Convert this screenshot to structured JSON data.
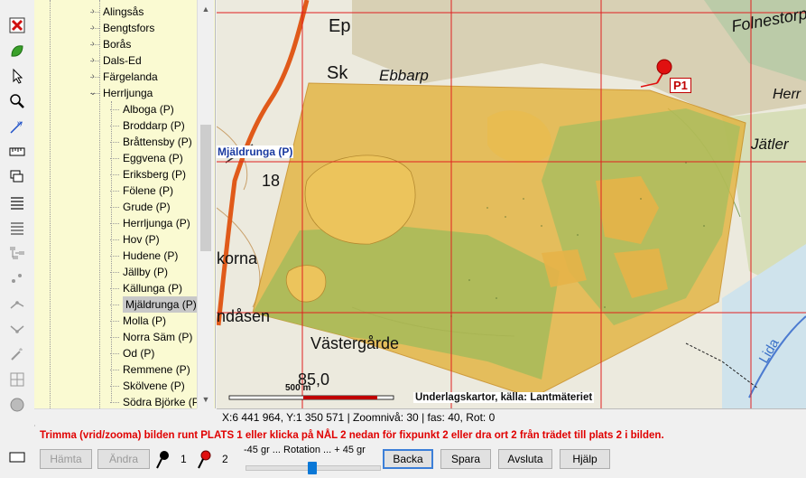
{
  "toolbar": {
    "tools": [
      "close-icon",
      "leaf-icon",
      "pointer-icon",
      "zoom-icon",
      "measure-icon",
      "ruler-icon",
      "layers-icon",
      "list-icon",
      "list2-icon",
      "network-icon",
      "dots-icon",
      "line-icon",
      "line2-icon",
      "wand-icon",
      "grid-icon",
      "circle-icon",
      "rectangle-icon"
    ]
  },
  "tree": {
    "top_items": [
      "Alingsås",
      "Bengtsfors",
      "Borås",
      "Dals-Ed",
      "Färgelanda"
    ],
    "expanded_item": "Herrljunga",
    "children": [
      "Alboga (P)",
      "Broddarp (P)",
      "Bråttensby (P)",
      "Eggvena (P)",
      "Eriksberg (P)",
      "Fölene (P)",
      "Grude (P)",
      "Herrljunga (P)",
      "Hov (P)",
      "Hudene (P)",
      "Jällby (P)",
      "Källunga (P)",
      "Mjäldrunga (P)",
      "Molla (P)",
      "Norra Säm (P)",
      "Od (P)",
      "Remmene (P)",
      "Skölvene (P)",
      "Södra Björke (P)"
    ],
    "selected": "Mjäldrunga (P)"
  },
  "map": {
    "labels": {
      "ep": "Ep",
      "ebbarp": "Ebbarp",
      "sk": "Sk",
      "mjaldrunga": "Mjäldrunga (P)",
      "num18": "18",
      "korna": "korna",
      "ndasen": "ndåsen",
      "vastergarde": "Västergårde",
      "num85": "85,0",
      "folnestorp": "Folnestorp",
      "jatler": "Jätler",
      "lida": "Lida",
      "herr": "Herr"
    },
    "marker_label": "P1",
    "scale_label": "500 m",
    "source_label": "Underlagskartor, källa: Lantmäteriet",
    "colors": {
      "overlay": "#e3b440",
      "grid": "#e02020",
      "road": "#e05a1a",
      "marker": "#e01010"
    }
  },
  "status": {
    "coords": "X:6 441 964, Y:1 350 571",
    "zoom": "Zoomnivå: 30",
    "fas": "fas: 40, Rot: 0"
  },
  "instruction": "Trimma (vrid/zooma) bilden runt PLATS 1 eller klicka på NÅL 2 nedan för fixpunkt 2 eller dra ort 2 från trädet till plats 2 i bilden.",
  "buttons": {
    "hamta": "Hämta",
    "andra": "Ändra",
    "pin1": "1",
    "pin2": "2",
    "backa": "Backa",
    "spara": "Spara",
    "avsluta": "Avsluta",
    "hjalp": "Hjälp"
  },
  "rotation": {
    "label": "-45 gr  ... Rotation ... + 45 gr",
    "value": 0
  }
}
